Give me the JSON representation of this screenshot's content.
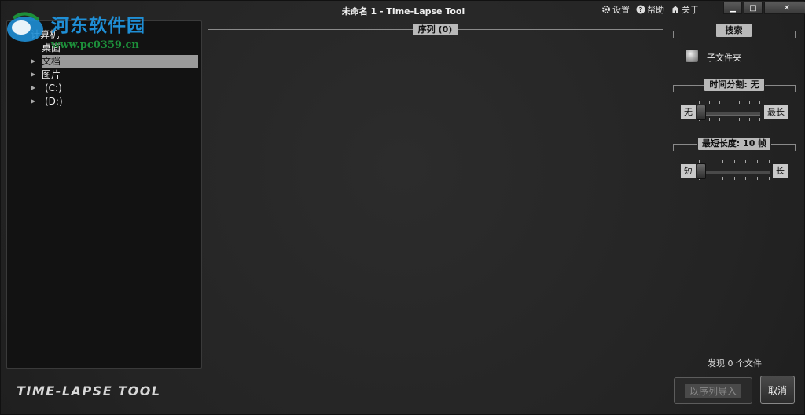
{
  "window": {
    "title": "未命名 1 - Time-Lapse Tool",
    "menu": [
      {
        "icon": "gear-icon",
        "label": "设置"
      },
      {
        "icon": "help-icon",
        "label": "帮助"
      },
      {
        "icon": "home-icon",
        "label": "关于"
      }
    ],
    "controls": {
      "minimize": "▁",
      "maximize": "□",
      "close": "✕"
    }
  },
  "watermark": {
    "name": "河东软件园",
    "url": "www.pc0359.cn"
  },
  "tree": {
    "items": [
      {
        "label": "计算机",
        "selected": false
      },
      {
        "label": "桌面",
        "selected": false
      },
      {
        "label": "文档",
        "selected": true
      },
      {
        "label": "图片",
        "selected": false
      },
      {
        "label": "(C:)",
        "selected": false
      },
      {
        "label": "(D:)",
        "selected": false
      }
    ]
  },
  "app_logo": "TIME-LAPSE TOOL",
  "sequence": {
    "label": "序列 (0)"
  },
  "search": {
    "label": "搜索",
    "subfolder_label": "子文件夹",
    "time_split": {
      "label": "时间分割: 无",
      "min_label": "无",
      "max_label": "最长",
      "value_fraction": 0.0
    },
    "min_length": {
      "label": "最短长度: 10 帧",
      "min_label": "短",
      "max_label": "长",
      "value_fraction": 0.0
    }
  },
  "status": {
    "found": "发现 0 个文件"
  },
  "buttons": {
    "import": "以序列导入",
    "cancel": "取消"
  }
}
